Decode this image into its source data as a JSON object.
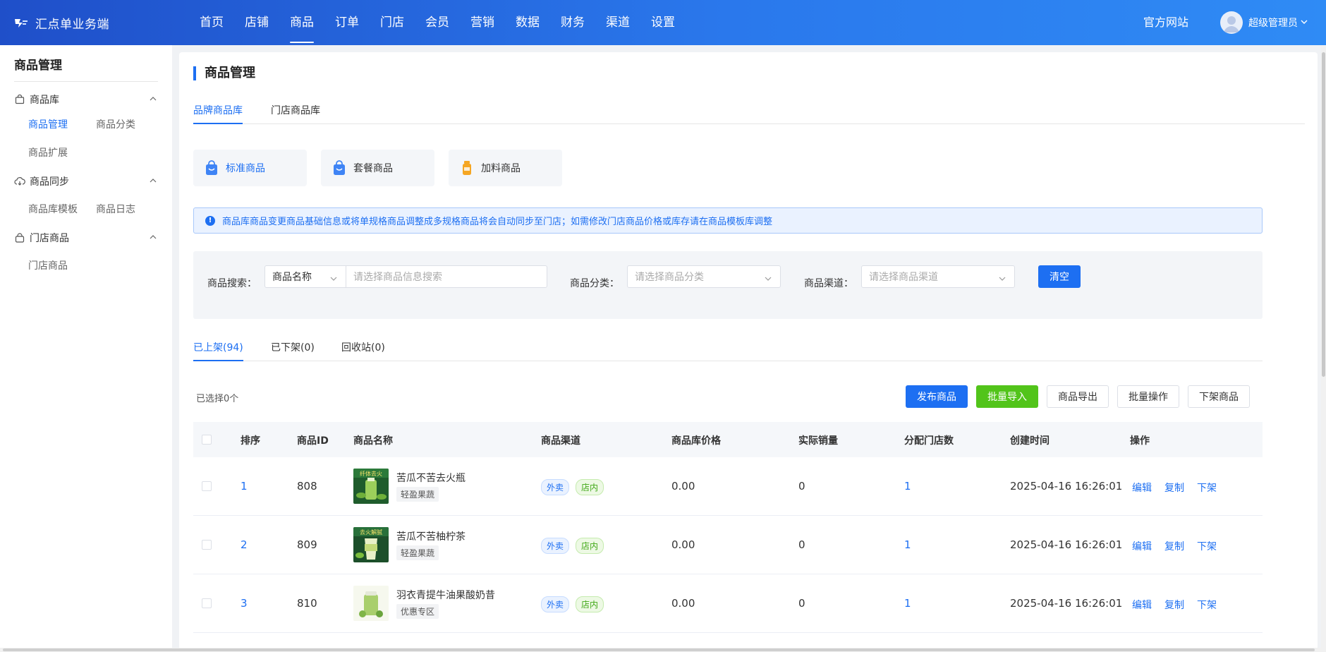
{
  "app": {
    "name": "汇点单业务端"
  },
  "topnav": [
    "首页",
    "店铺",
    "商品",
    "订单",
    "门店",
    "会员",
    "营销",
    "数据",
    "财务",
    "渠道",
    "设置"
  ],
  "header": {
    "official_site": "官方网站",
    "user_name": "超级管理员"
  },
  "sidebar": {
    "title": "商品管理",
    "groups": [
      {
        "label": "商品库",
        "icon": "bag-icon",
        "items": [
          "商品管理",
          "商品分类",
          "商品扩展"
        ]
      },
      {
        "label": "商品同步",
        "icon": "cloud-sync-icon",
        "items": [
          "商品库模板",
          "商品日志"
        ]
      },
      {
        "label": "门店商品",
        "icon": "lock-bag-icon",
        "items": [
          "门店商品"
        ]
      }
    ]
  },
  "page": {
    "title": "商品管理",
    "lib_tabs": [
      "品牌商品库",
      "门店商品库"
    ],
    "type_cards": [
      "标准商品",
      "套餐商品",
      "加料商品"
    ],
    "notice": "商品库商品变更商品基础信息或将单规格商品调整成多规格商品将会自动同步至门店；如需修改门店商品价格或库存请在商品模板库调整"
  },
  "filter": {
    "search_label": "商品搜索：",
    "search_field": "商品名称",
    "search_placeholder": "请选择商品信息搜索",
    "category_label": "商品分类：",
    "category_placeholder": "请选择商品分类",
    "channel_label": "商品渠道：",
    "channel_placeholder": "请选择商品渠道",
    "clear_button": "清空"
  },
  "status_tabs": [
    "已上架(94)",
    "已下架(0)",
    "回收站(0)"
  ],
  "toolbar": {
    "selected": "已选择0个",
    "buttons": [
      "发布商品",
      "批量导入",
      "商品导出",
      "批量操作",
      "下架商品"
    ]
  },
  "table": {
    "headers": [
      "排序",
      "商品ID",
      "商品名称",
      "商品渠道",
      "商品库价格",
      "实际销量",
      "分配门店数",
      "创建时间",
      "操作"
    ],
    "rows": [
      {
        "sort": "1",
        "id": "808",
        "name": "苦瓜不苦去火瓶",
        "tag": "轻盈果蔬",
        "channels": [
          "外卖",
          "店内"
        ],
        "price": "0.00",
        "sales": "0",
        "stores": "1",
        "created": "2025-04-16 16:26:01",
        "thumb_text": "纤体去火"
      },
      {
        "sort": "2",
        "id": "809",
        "name": "苦瓜不苦柚柠茶",
        "tag": "轻盈果蔬",
        "channels": [
          "外卖",
          "店内"
        ],
        "price": "0.00",
        "sales": "0",
        "stores": "1",
        "created": "2025-04-16 16:26:01",
        "thumb_text": "去火解腻"
      },
      {
        "sort": "3",
        "id": "810",
        "name": "羽衣青提牛油果酸奶昔",
        "tag": "优惠专区",
        "channels": [
          "外卖",
          "店内"
        ],
        "price": "0.00",
        "sales": "0",
        "stores": "1",
        "created": "2025-04-16 16:26:01",
        "thumb_text": ""
      }
    ],
    "actions": [
      "编辑",
      "复制",
      "下架"
    ]
  },
  "colors": {
    "primary": "#1d6ff2",
    "success": "#52c41a",
    "header_start": "#1f4fc9",
    "header_end": "#2f8bf5"
  }
}
